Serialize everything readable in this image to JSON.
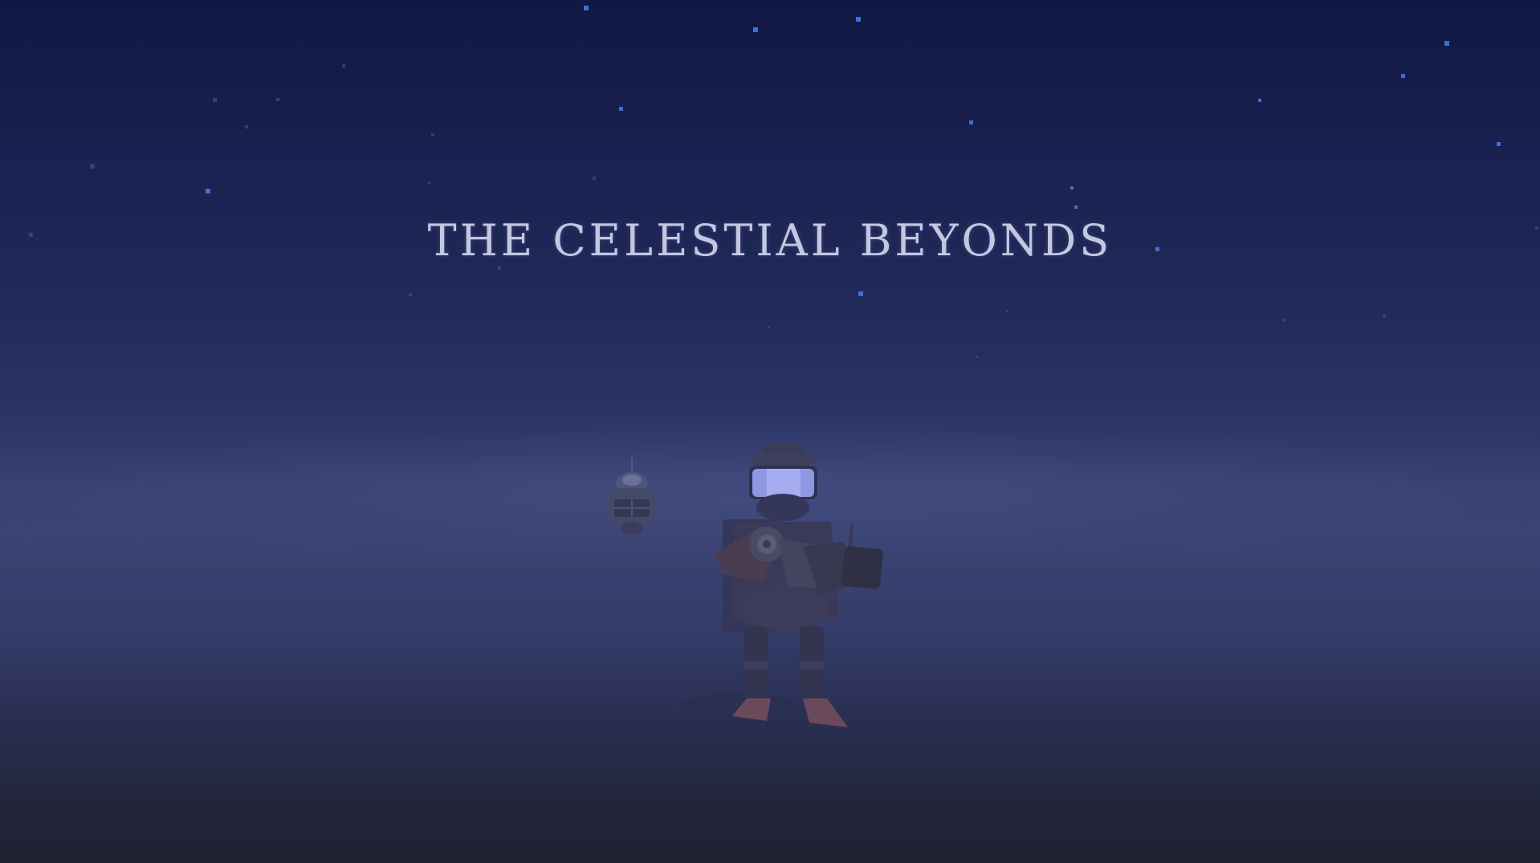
{
  "game": {
    "title": "THE CELESTIAL BEYONDS"
  },
  "scene": {
    "colors": {
      "sky_top": "#111842",
      "horizon": "#3a4372",
      "ground": "#1f2230",
      "title_text": "#c3c7e2",
      "star": "#3f6fd8"
    },
    "icons": {
      "character": "astronaut-soldier-icon",
      "drone": "floating-drone-icon",
      "stars": "starfield-icon"
    }
  }
}
